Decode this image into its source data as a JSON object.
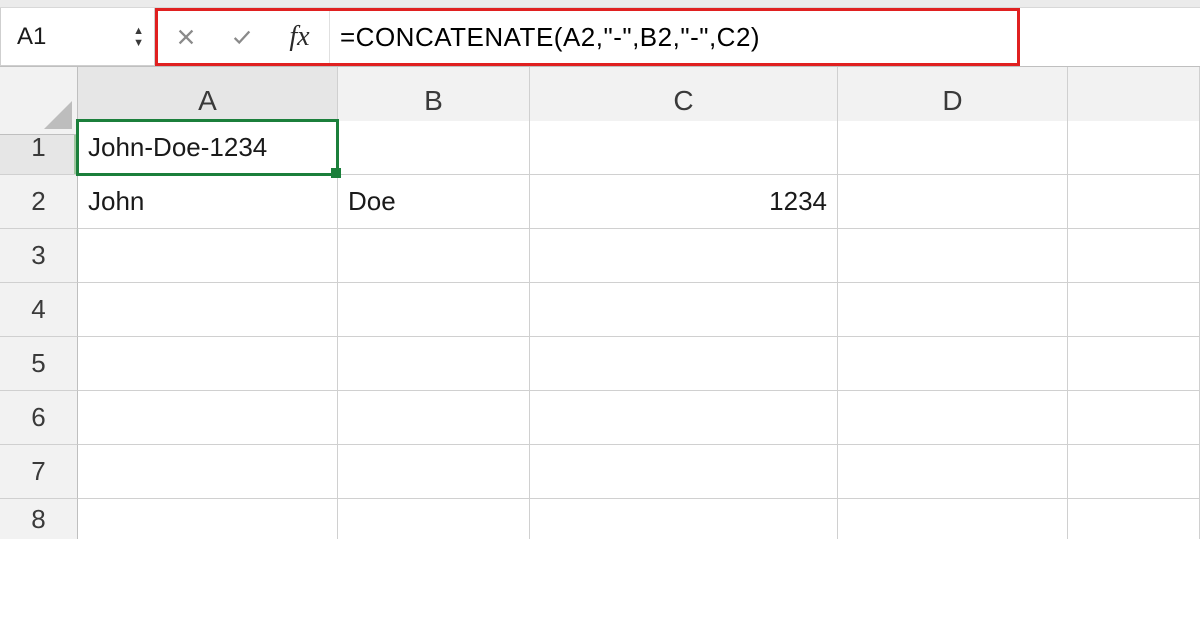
{
  "formula_bar": {
    "name_box_value": "A1",
    "fx_label": "fx",
    "formula": "=CONCATENATE(A2,\"-\",B2,\"-\",C2)"
  },
  "columns": [
    "A",
    "B",
    "C",
    "D",
    ""
  ],
  "rows": [
    "1",
    "2",
    "3",
    "4",
    "5",
    "6",
    "7",
    "8"
  ],
  "selected_cell": "A1",
  "cells": {
    "A1": "John-Doe-1234",
    "A2": "John",
    "B2": "Doe",
    "C2": "1234"
  },
  "icons": {
    "cancel": "close-icon",
    "confirm": "check-icon",
    "stepper_up": "▲",
    "stepper_down": "▼"
  },
  "colors": {
    "selection": "#1b7f3b",
    "highlight_box": "#e02020"
  }
}
